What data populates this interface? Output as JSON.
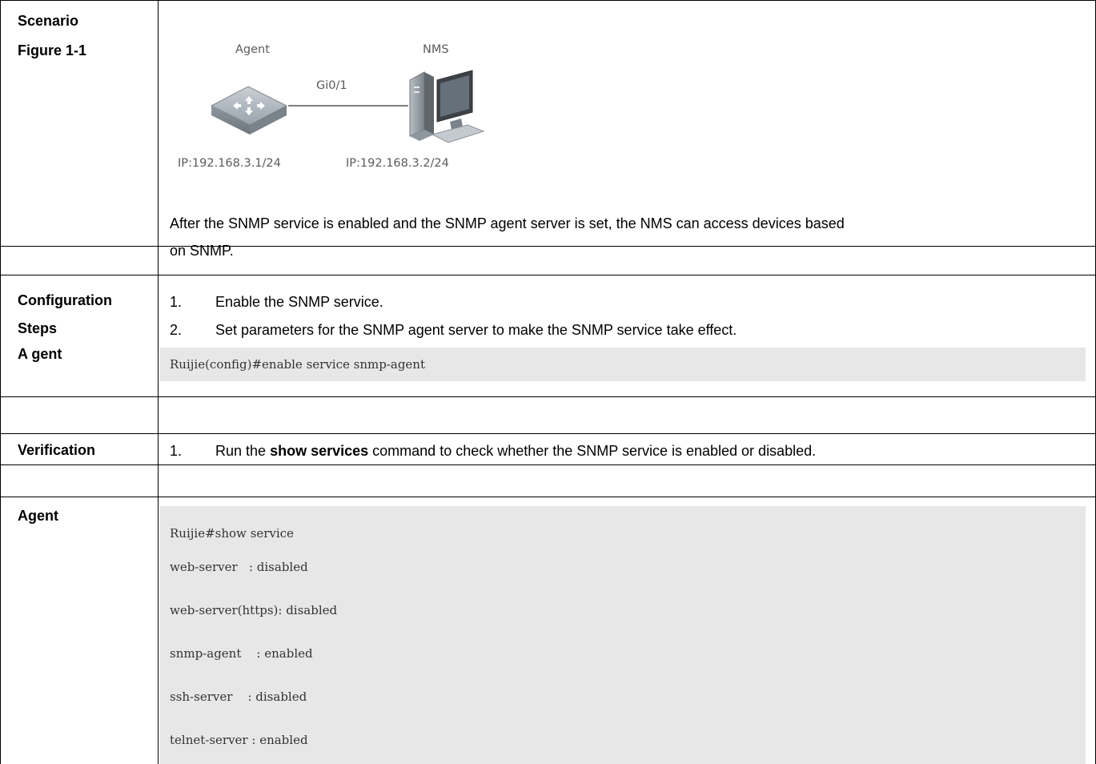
{
  "rows": {
    "scenario": {
      "label_line1": "Scenario",
      "label_line2": "Figure 1-1",
      "figure": {
        "agent_label": "Agent",
        "nms_label": "NMS",
        "link_label": "Gi0/1",
        "agent_ip": "IP:192.168.3.1/24",
        "nms_ip": "IP:192.168.3.2/24",
        "agent_icon": "switch-icon",
        "nms_icon": "pc-workstation-icon"
      },
      "description_line1": "After the SNMP service is enabled and the SNMP agent server is set, the NMS can access devices based",
      "description_line2": "on SNMP."
    },
    "config_steps": {
      "label_line1": "Configuration",
      "label_line2": "Steps",
      "steps": [
        {
          "num": "1.",
          "text": "Enable the SNMP service."
        },
        {
          "num": "2.",
          "text": "Set parameters for the SNMP agent server to make the SNMP service take effect."
        }
      ]
    },
    "agent_config": {
      "label": "A gent",
      "code": "Ruijie(config)#enable service snmp-agent"
    },
    "verification": {
      "label": "Verification",
      "num": "1.",
      "text_before": "Run the",
      "command": "show services",
      "text_after": "command to check whether the SNMP service is enabled or disabled."
    },
    "agent_output": {
      "label": "Agent",
      "lines": [
        "Ruijie#show service",
        "web-server   : disabled",
        "web-server(https): disabled",
        "snmp-agent    : enabled",
        "ssh-server    : disabled",
        "telnet-server : enabled"
      ]
    }
  },
  "colors": {
    "code_background": "#e7e7e7",
    "code_text": "#333333",
    "border": "#000000",
    "diagram_text": "#5b5b5b"
  }
}
